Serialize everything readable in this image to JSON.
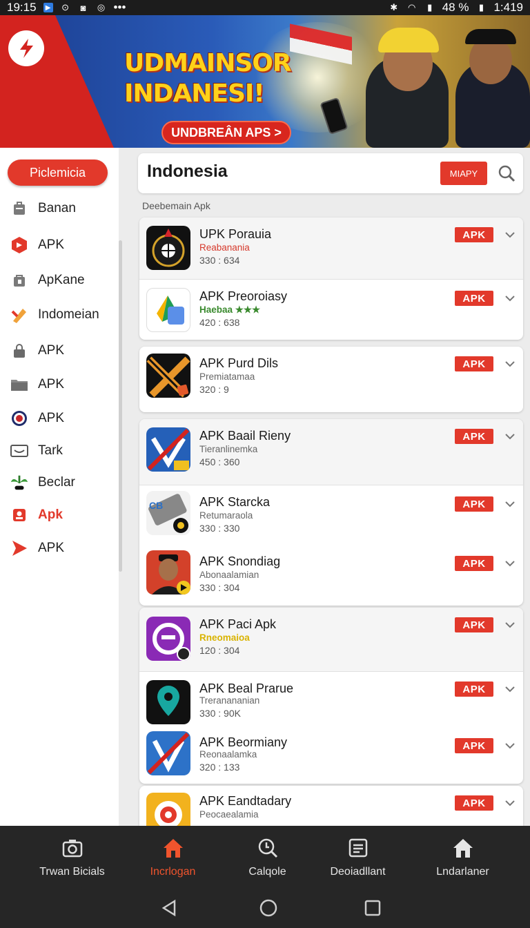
{
  "status_bar": {
    "time": "19:15",
    "dots": "•••",
    "battery": "48 %",
    "right_time": "1:419"
  },
  "banner": {
    "headline_line1": "UDMAINSOR",
    "headline_line2": "INDANESI!",
    "cta_label": "UNDBREÂN APS >"
  },
  "sidebar": {
    "primary_button": "Piclemicia",
    "items": [
      {
        "label": "Banan",
        "icon": "briefcase-icon",
        "active": false
      },
      {
        "label": "APK",
        "icon": "hexagon-apk-icon",
        "active": false
      },
      {
        "label": "ApKane",
        "icon": "bag-icon",
        "active": false
      },
      {
        "label": "Indomeian",
        "icon": "pen-icon",
        "active": false
      },
      {
        "label": "APK",
        "icon": "lock-icon",
        "active": false
      },
      {
        "label": "APK",
        "icon": "folder-icon",
        "active": false
      },
      {
        "label": "APK",
        "icon": "disc-icon",
        "active": false
      },
      {
        "label": "Tark",
        "icon": "mail-icon",
        "active": false
      },
      {
        "label": "Beclar",
        "icon": "plant-icon",
        "active": false
      },
      {
        "label": "Apk",
        "icon": "badge-icon",
        "active": true
      },
      {
        "label": "APK",
        "icon": "play-icon",
        "active": false
      }
    ]
  },
  "search": {
    "title": "Indonesia",
    "chip_label": "MIAPY"
  },
  "section_label": "Deebemain Apk",
  "apps": [
    {
      "name": "UPK Porauia",
      "sub": "Reabanania",
      "nums": "330 : 634",
      "badge": "APK"
    },
    {
      "name": "APK Preoroiasy",
      "sub": "Haebaa ★★★",
      "nums": "420 : 638",
      "badge": "APK"
    },
    {
      "name": "APK Purd Dils",
      "sub": "Premiatamaa",
      "nums": "320 : 9",
      "badge": "APK"
    },
    {
      "name": "APK Baail Rieny",
      "sub": "Tieranlinemka",
      "nums": "450 : 360",
      "badge": "APK"
    },
    {
      "name": "APK Starcka",
      "sub": "Retumaraola",
      "nums": "330 : 330",
      "badge": "APK"
    },
    {
      "name": "APK Snondiag",
      "sub": "Abonaalamian",
      "nums": "330 : 304",
      "badge": "APK"
    },
    {
      "name": "APK Paci Apk",
      "sub": "Rneomaioa",
      "nums": "120 : 304",
      "badge": "APK"
    },
    {
      "name": "APK Beal Prarue",
      "sub": "Treranananian",
      "nums": "330 : 90K",
      "badge": "APK"
    },
    {
      "name": "APK Beormiany",
      "sub": "Reonaalamka",
      "nums": "320 : 133",
      "badge": "APK"
    },
    {
      "name": "APK Eandtadary",
      "sub": "Peocaealamia",
      "nums": "",
      "badge": "APK"
    }
  ],
  "bottom_nav": [
    {
      "label": "Trwan Bicials",
      "icon": "camera-icon",
      "active": false
    },
    {
      "label": "Incrlogan",
      "icon": "home-icon",
      "active": true
    },
    {
      "label": "Calqole",
      "icon": "search-clock-icon",
      "active": false
    },
    {
      "label": "Deoiadllant",
      "icon": "document-icon",
      "active": false
    },
    {
      "label": "Lndarlaner",
      "icon": "house-icon",
      "active": false
    }
  ],
  "colors": {
    "accent": "#e2392b",
    "active_nav": "#f0542d",
    "nav_bg": "#262626"
  }
}
